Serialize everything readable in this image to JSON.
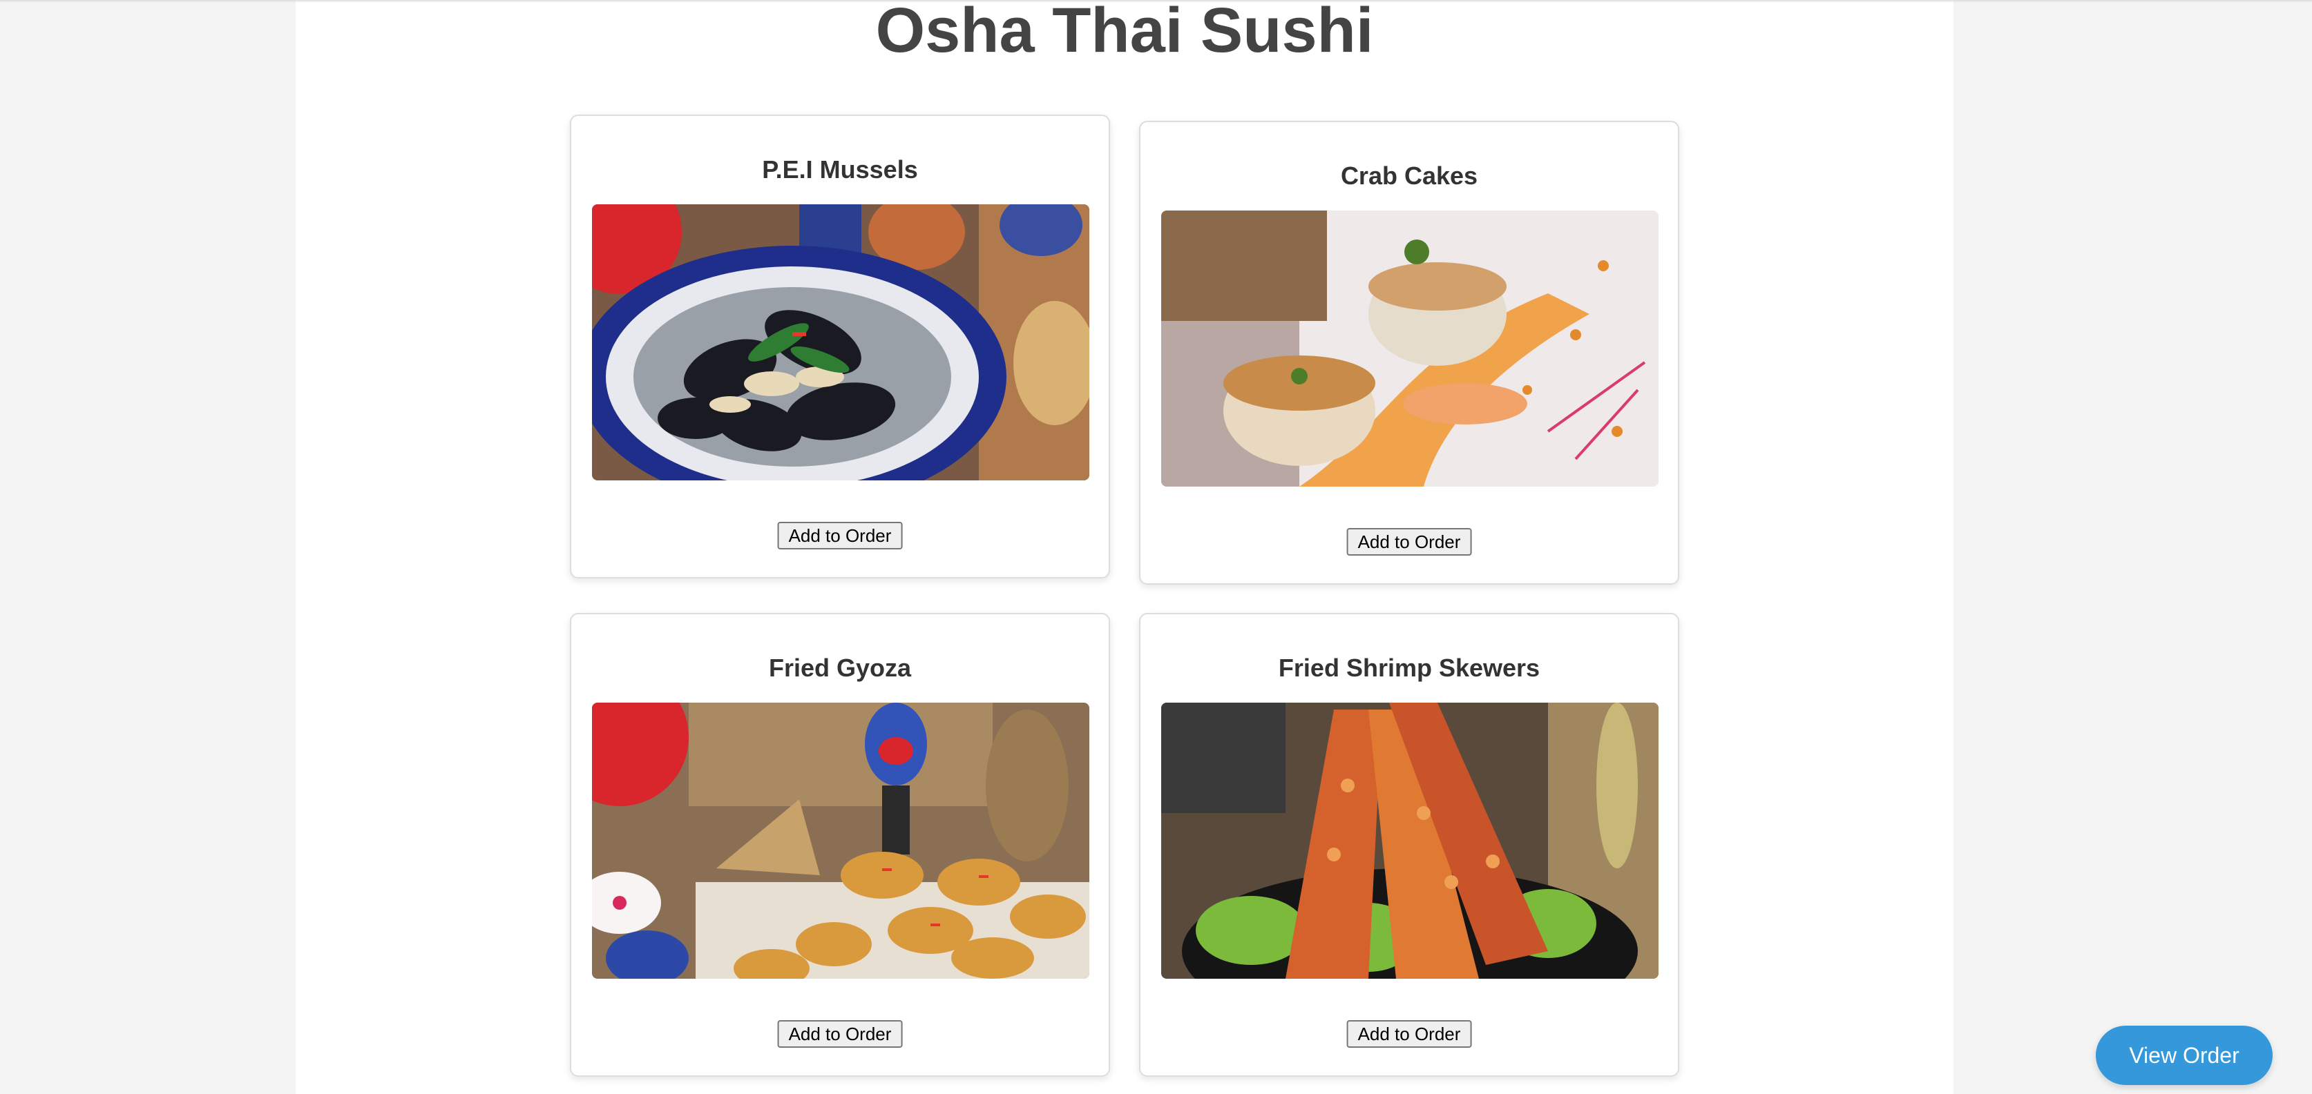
{
  "page": {
    "title": "Osha Thai Sushi"
  },
  "menu": {
    "items": [
      {
        "name": "P.E.I Mussels",
        "button_label": "Add to Order",
        "image_alt": "mussels-dish-photo"
      },
      {
        "name": "Crab Cakes",
        "button_label": "Add to Order",
        "image_alt": "crab-cakes-photo"
      },
      {
        "name": "Fried Gyoza",
        "button_label": "Add to Order",
        "image_alt": "fried-gyoza-photo"
      },
      {
        "name": "Fried Shrimp Skewers",
        "button_label": "Add to Order",
        "image_alt": "fried-shrimp-skewers-photo"
      }
    ]
  },
  "order": {
    "view_label": "View Order"
  },
  "colors": {
    "accent": "#3498db",
    "title_text": "#444444",
    "card_border": "#dddddd",
    "page_bg": "#f4f4f4"
  }
}
